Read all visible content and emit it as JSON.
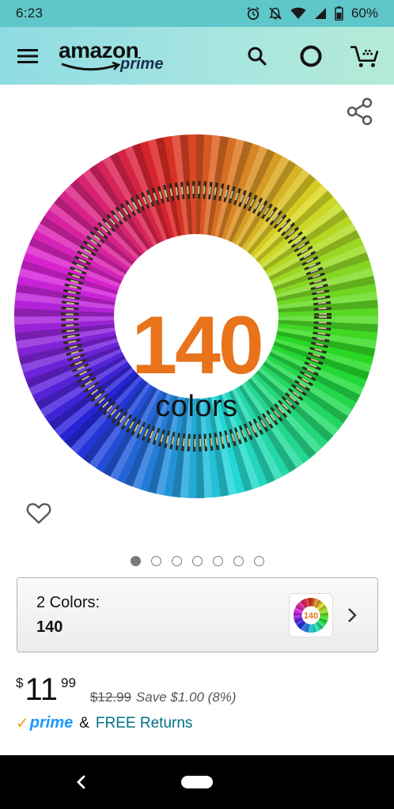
{
  "status_bar": {
    "time": "6:23",
    "battery": "60%",
    "icons": [
      "alarm-icon",
      "notifications-off-icon",
      "wifi-icon",
      "signal-icon",
      "battery-icon"
    ]
  },
  "header": {
    "logo_text": "amazon",
    "logo_sub": "prime",
    "icons": [
      "menu-icon",
      "search-icon",
      "alexa-icon",
      "cart-icon"
    ],
    "colors": {
      "gradient_start": "#8fdbe3",
      "gradient_end": "#b4ead7"
    }
  },
  "product": {
    "image_headline": "140",
    "image_caption": "colors",
    "accent_color": "#e8731a",
    "carousel": {
      "total": 7,
      "active": 1
    }
  },
  "variation": {
    "label": "2 Colors:",
    "value": "140",
    "thumb_text": "140"
  },
  "price": {
    "symbol": "$",
    "whole": "11",
    "fraction": "99",
    "list_price": "$12.99",
    "savings": "Save $1.00 (8%)"
  },
  "prime": {
    "badge": "prime",
    "separator": "&",
    "free_returns": "FREE Returns"
  }
}
